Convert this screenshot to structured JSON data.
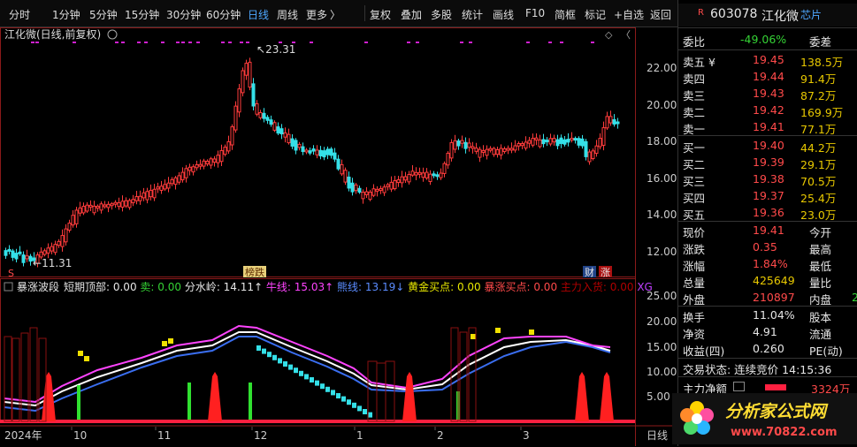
{
  "toolbar": {
    "periods": [
      "分时",
      "1分钟",
      "5分钟",
      "15分钟",
      "30分钟",
      "60分钟",
      "日线",
      "周线",
      "更多"
    ],
    "active_period": "日线",
    "more_chevron": "〉",
    "tools": [
      "复权",
      "叠加",
      "多股",
      "统计",
      "画线",
      "F10",
      "简框",
      "标记",
      "+自选",
      "返回"
    ]
  },
  "chart": {
    "title": "江化微(日线,前复权)",
    "high_label": "23.31",
    "low_label": "11.31",
    "price_ticks": [
      "22.00",
      "20.00",
      "18.00",
      "16.00",
      "14.00",
      "12.00"
    ],
    "tags": {
      "s_tag": "S",
      "rise_tag": "榜跌",
      "fin_tag": "财",
      "up_tag": "涨"
    }
  },
  "indicator": {
    "name": "暴涨波段",
    "items": [
      {
        "label": "短期顶部:",
        "value": "0.00",
        "color": "#e6e6e6"
      },
      {
        "label": "卖:",
        "value": "0.00",
        "color": "#35d335"
      },
      {
        "label": "分水岭:",
        "value": "14.11↑",
        "color": "#e6e6e6"
      },
      {
        "label": "牛线:",
        "value": "15.03↑",
        "color": "#ff44ff"
      },
      {
        "label": "熊线:",
        "value": "13.19↓",
        "color": "#5b8cff"
      },
      {
        "label": "黄金买点:",
        "value": "0.00",
        "color": "#e8e800"
      },
      {
        "label": "暴涨买点:",
        "value": "0.00",
        "color": "#ff4a4a"
      },
      {
        "label": "主力入货:",
        "value": "0.00",
        "color": "#b00000"
      },
      {
        "label": "XG",
        "value": "",
        "color": "#c040ff"
      }
    ],
    "ticks": [
      "25.00",
      "20.00",
      "15.00",
      "10.00",
      "5.00"
    ]
  },
  "xaxis": {
    "labels": [
      "2024年",
      "10",
      "11",
      "12",
      "1",
      "2",
      "3"
    ],
    "period": "日线"
  },
  "quote": {
    "code": "603078",
    "name": "江化微",
    "badge": "芯片",
    "r_tag": "R",
    "weibi": {
      "label": "委比",
      "value": "-49.06%",
      "right": "委差"
    },
    "sells": [
      {
        "label": "卖五 ¥",
        "price": "19.45",
        "vol": "138.5万"
      },
      {
        "label": "卖四",
        "price": "19.44",
        "vol": "91.4万"
      },
      {
        "label": "卖三",
        "price": "19.43",
        "vol": "87.2万"
      },
      {
        "label": "卖二",
        "price": "19.42",
        "vol": "169.9万"
      },
      {
        "label": "卖一",
        "price": "19.41",
        "vol": "77.1万"
      }
    ],
    "buys": [
      {
        "label": "买一",
        "price": "19.40",
        "vol": "44.2万"
      },
      {
        "label": "买二",
        "price": "19.39",
        "vol": "29.1万"
      },
      {
        "label": "买三",
        "price": "19.38",
        "vol": "70.5万"
      },
      {
        "label": "买四",
        "price": "19.37",
        "vol": "25.4万"
      },
      {
        "label": "买五",
        "price": "19.36",
        "vol": "23.0万"
      }
    ],
    "stats": [
      {
        "l": "现价",
        "v": "19.41",
        "r": "今开",
        "c": "red"
      },
      {
        "l": "涨跌",
        "v": "0.35",
        "r": "最高",
        "c": "red"
      },
      {
        "l": "涨幅",
        "v": "1.84%",
        "r": "最低",
        "c": "red"
      },
      {
        "l": "总量",
        "v": "425649",
        "r": "量比",
        "c": "yellow"
      },
      {
        "l": "外盘",
        "v": "210897",
        "r": "内盘",
        "c": "red",
        "extra": "2"
      }
    ],
    "stats2": [
      {
        "l": "换手",
        "v": "11.04%",
        "r": "股本"
      },
      {
        "l": "净资",
        "v": "4.91",
        "r": "流通"
      },
      {
        "l": "收益(四)",
        "v": "0.260",
        "r": "PE(动)"
      }
    ],
    "trade_status": "交易状态: 连续竞价 14:15:36",
    "main_net": {
      "label": "主力净额",
      "value": "3324万"
    }
  },
  "watermark": {
    "text": "分析家公式网",
    "url": "www.70822.com"
  }
}
